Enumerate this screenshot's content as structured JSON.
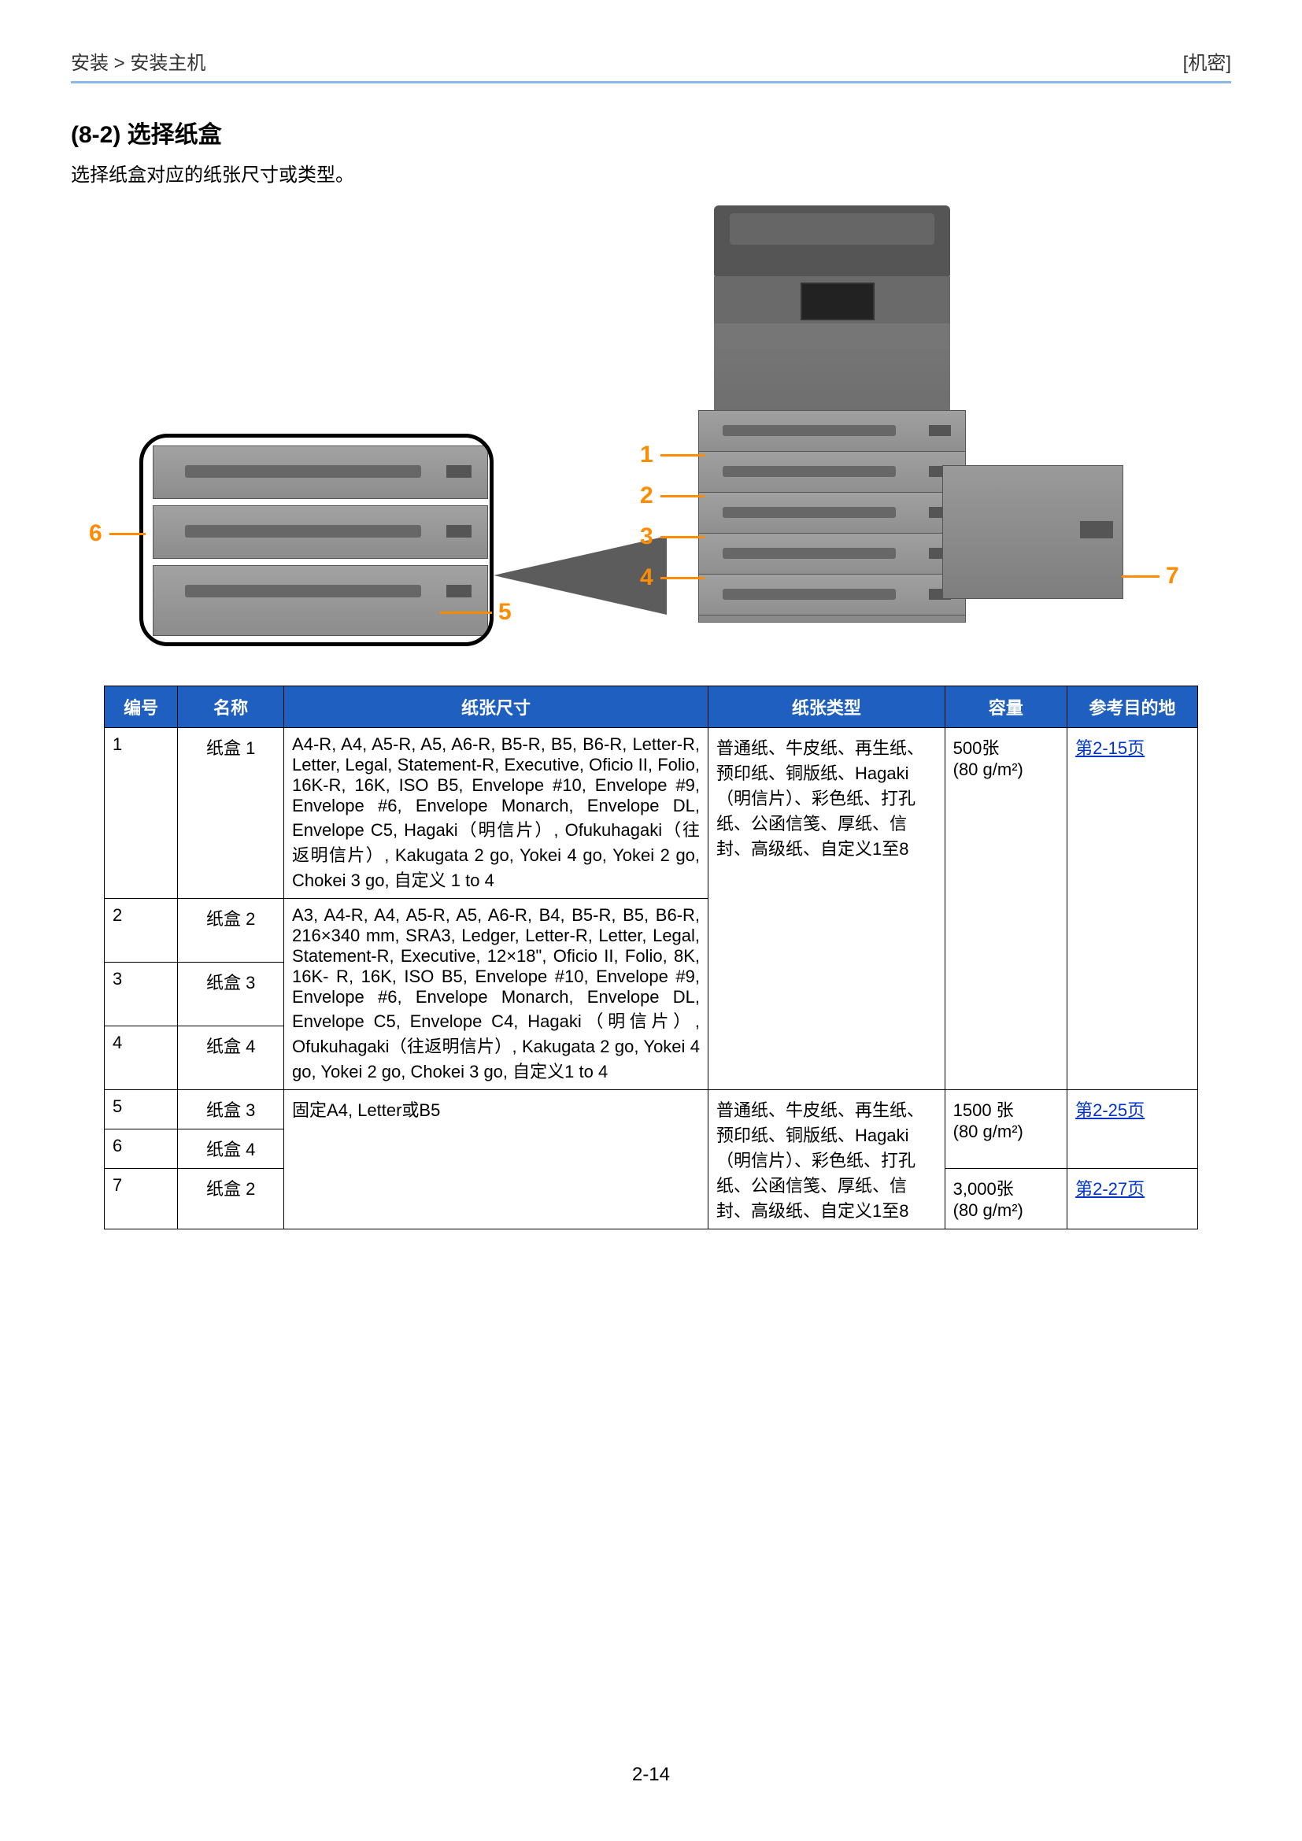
{
  "header": {
    "breadcrumb": "安装 > 安装主机",
    "confidential": "[机密]"
  },
  "section": {
    "title": "(8-2) 选择纸盒",
    "description": "选择纸盒对应的纸张尺寸或类型。"
  },
  "callouts": {
    "c1": "1",
    "c2": "2",
    "c3": "3",
    "c4": "4",
    "c5": "5",
    "c6": "6",
    "c7": "7"
  },
  "table": {
    "headers": {
      "no": "编号",
      "name": "名称",
      "size": "纸张尺寸",
      "type": "纸张类型",
      "capacity": "容量",
      "ref": "参考目的地"
    },
    "rows": {
      "r1_no": "1",
      "r1_name": "纸盒 1",
      "r1_size": "A4-R, A4, A5-R, A5, A6-R, B5-R, B5, B6-R, Letter-R, Letter, Legal, Statement-R, Executive, Oficio II, Folio, 16K-R, 16K, ISO B5, Envelope #10, Envelope #9, Envelope #6, Envelope Monarch, Envelope DL, Envelope C5, Hagaki（明信片）, Ofukuhagaki（往返明信片）, Kakugata 2 go, Yokei 4 go, Yokei 2 go, Chokei 3 go, 自定义 1 to 4",
      "type_group1": "普通纸、牛皮纸、再生纸、预印纸、铜版纸、Hagaki（明信片）、彩色纸、打孔纸、公函信笺、厚纸、信封、高级纸、自定义1至8",
      "cap_group1_line1": "500张",
      "cap_group1_line2": "(80 g/m²)",
      "ref_group1": "第2-15页",
      "r2_no": "2",
      "r2_name": "纸盒 2",
      "size_group2": "A3, A4-R, A4, A5-R, A5, A6-R, B4, B5-R, B5, B6-R, 216×340 mm, SRA3, Ledger, Letter-R, Letter, Legal, Statement-R, Executive, 12×18\", Oficio II, Folio, 8K, 16K- R, 16K, ISO B5, Envelope #10, Envelope #9, Envelope #6, Envelope Monarch, Envelope DL, Envelope C5, Envelope C4, Hagaki（明信片）, Ofukuhagaki（往返明信片）, Kakugata 2 go, Yokei 4 go, Yokei 2 go, Chokei 3 go, 自定义1 to 4",
      "r3_no": "3",
      "r3_name": "纸盒 3",
      "r4_no": "4",
      "r4_name": "纸盒 4",
      "r5_no": "5",
      "r5_name": "纸盒 3",
      "size_group3": "固定A4, Letter或B5",
      "type_group3": "普通纸、牛皮纸、再生纸、预印纸、铜版纸、Hagaki（明信片）、彩色纸、打孔纸、公函信笺、厚纸、信封、高级纸、自定义1至8",
      "cap_group3a_line1": "1500 张",
      "cap_group3a_line2": "(80 g/m²)",
      "ref_group3a": "第2-25页",
      "r6_no": "6",
      "r6_name": "纸盒 4",
      "r7_no": "7",
      "r7_name": "纸盒 2",
      "cap_group3b_line1": "3,000张",
      "cap_group3b_line2": "(80 g/m²)",
      "ref_group3b": "第2-27页"
    }
  },
  "page_number": "2-14"
}
